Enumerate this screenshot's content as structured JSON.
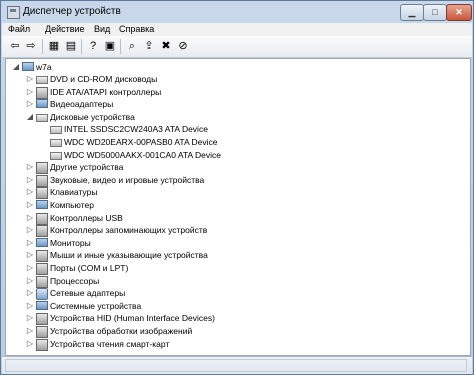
{
  "window": {
    "title": "Диспетчер устройств",
    "minimize_label": "▁",
    "maximize_label": "□",
    "close_label": "✕"
  },
  "menu": [
    "Файл",
    "Действие",
    "Вид",
    "Справка"
  ],
  "toolbar": [
    {
      "name": "back-arrow-icon",
      "glyph": "⇦"
    },
    {
      "name": "forward-arrow-icon",
      "glyph": "⇨"
    },
    {
      "name": "properties-icon",
      "glyph": "▦"
    },
    {
      "name": "document-icon",
      "glyph": "▤"
    },
    {
      "name": "help-icon",
      "glyph": "?"
    },
    {
      "name": "view-icon",
      "glyph": "▣"
    },
    {
      "name": "scan-hardware-icon",
      "glyph": "⌕"
    },
    {
      "name": "update-driver-icon",
      "glyph": "⇪"
    },
    {
      "name": "uninstall-icon",
      "glyph": "✖"
    },
    {
      "name": "disable-icon",
      "glyph": "⊘"
    }
  ],
  "tree": {
    "root": "w7a",
    "items": [
      {
        "label": "DVD и CD-ROM дисководы",
        "level": 1,
        "icon": "drive",
        "expand": "▷"
      },
      {
        "label": "IDE ATA/ATAPI контроллеры",
        "level": 1,
        "icon": "device",
        "expand": "▷"
      },
      {
        "label": "Видеоадаптеры",
        "level": 1,
        "icon": "computer",
        "expand": "▷"
      },
      {
        "label": "Дисковые устройства",
        "level": 1,
        "icon": "drive",
        "expand": "◢"
      },
      {
        "label": "INTEL SSDSC2CW240A3 ATA Device",
        "level": 2,
        "icon": "drive",
        "expand": ""
      },
      {
        "label": "WDC WD20EARX-00PASB0 ATA Device",
        "level": 2,
        "icon": "drive",
        "expand": ""
      },
      {
        "label": "WDC WD5000AAKX-001CA0 ATA Device",
        "level": 2,
        "icon": "drive",
        "expand": ""
      },
      {
        "label": "Другие устройства",
        "level": 1,
        "icon": "device",
        "expand": "▷"
      },
      {
        "label": "Звуковые, видео и игровые устройства",
        "level": 1,
        "icon": "device",
        "expand": "▷"
      },
      {
        "label": "Клавиатуры",
        "level": 1,
        "icon": "device",
        "expand": "▷"
      },
      {
        "label": "Компьютер",
        "level": 1,
        "icon": "computer",
        "expand": "▷"
      },
      {
        "label": "Контроллеры USB",
        "level": 1,
        "icon": "device",
        "expand": "▷"
      },
      {
        "label": "Контроллеры запоминающих устройств",
        "level": 1,
        "icon": "device",
        "expand": "▷"
      },
      {
        "label": "Мониторы",
        "level": 1,
        "icon": "computer",
        "expand": "▷"
      },
      {
        "label": "Мыши и иные указывающие устройства",
        "level": 1,
        "icon": "device",
        "expand": "▷"
      },
      {
        "label": "Порты (COM и LPT)",
        "level": 1,
        "icon": "device",
        "expand": "▷"
      },
      {
        "label": "Процессоры",
        "level": 1,
        "icon": "device",
        "expand": "▷"
      },
      {
        "label": "Сетевые адаптеры",
        "level": 1,
        "icon": "net",
        "expand": "▷"
      },
      {
        "label": "Системные устройства",
        "level": 1,
        "icon": "computer",
        "expand": "▷"
      },
      {
        "label": "Устройства HID (Human Interface Devices)",
        "level": 1,
        "icon": "device",
        "expand": "▷"
      },
      {
        "label": "Устройства обработки изображений",
        "level": 1,
        "icon": "device",
        "expand": "▷"
      },
      {
        "label": "Устройства чтения смарт-карт",
        "level": 1,
        "icon": "device",
        "expand": "▷"
      }
    ]
  }
}
